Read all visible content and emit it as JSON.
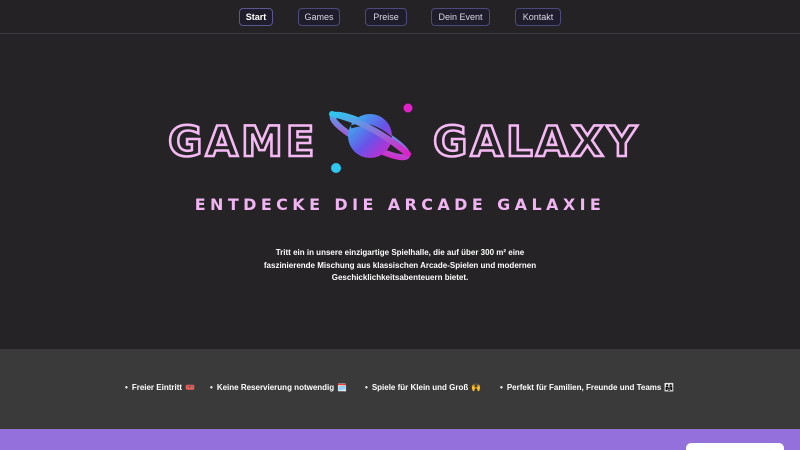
{
  "nav": {
    "items": [
      {
        "label": "Start",
        "active": true
      },
      {
        "label": "Games",
        "active": false
      },
      {
        "label": "Preise",
        "active": false
      },
      {
        "label": "Dein Event",
        "active": false
      },
      {
        "label": "Kontakt",
        "active": false
      }
    ]
  },
  "hero": {
    "logo_left": "GAME",
    "logo_right": "GALAXY",
    "logo_icon": "planet-icon",
    "tagline": "ENTDECKE DIE ARCADE GALAXIE",
    "intro_lines": [
      "Tritt ein in unsere einzigartige Spielhalle, die auf über 300 m² eine",
      "faszinierende Mischung aus klassischen Arcade-Spielen und modernen",
      "Geschicklichkeitsabenteuern bietet."
    ]
  },
  "features": [
    {
      "text": "Freier Eintritt",
      "emoji": "🎟️"
    },
    {
      "text": "Keine Reservierung notwendig",
      "emoji": "🗓️"
    },
    {
      "text": "Spiele für Klein und Groß",
      "emoji": "🙌"
    },
    {
      "text": "Perfekt für Familien, Freunde und Teams",
      "emoji": "👨‍👩‍👧"
    }
  ],
  "colors": {
    "background": "#252325",
    "accent_pink": "#f4b9f2",
    "band_purple": "#9370db",
    "planet_cyan": "#2ec7f0",
    "planet_magenta": "#e020c8"
  }
}
